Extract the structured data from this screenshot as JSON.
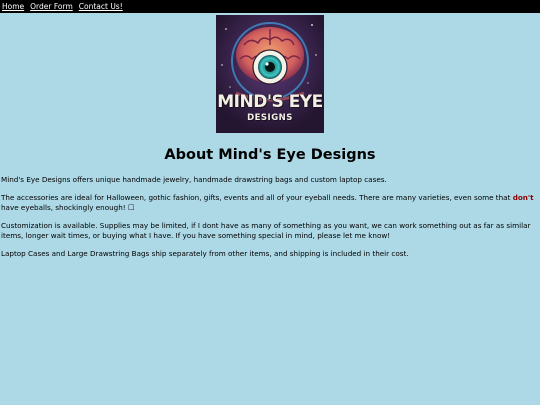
{
  "nav": {
    "links": [
      "Home",
      "Order Form",
      "Contact Us!"
    ]
  },
  "logo": {
    "title": "MIND'S EYE",
    "subtitle": "DESIGNS"
  },
  "page": {
    "heading": "About Mind's Eye Designs",
    "p1": "Mind's Eye Designs offers unique handmade jewelry, handmade drawstring bags and custom laptop cases.",
    "p2_before": "The accessories are ideal for Halloween, gothic fashion, gifts, events and all of your eyeball needs. There are many varieties, even some that ",
    "p2_emph": "don't",
    "p2_after": " have eyeballs, shockingly enough! ☐",
    "p3": "Customization is available. Supplies may be limited, if I dont have as many of something as you want, we can work something out as far as similar items, longer wait times, or buying what I have. If you have something special in mind, please let me know!",
    "p4": "Laptop Cases and Large Drawstring Bags ship separately from other items, and shipping is included in their cost."
  },
  "colors": {
    "background": "#add8e6",
    "nav_bg": "#000000",
    "emphasis": "#8b0000"
  }
}
